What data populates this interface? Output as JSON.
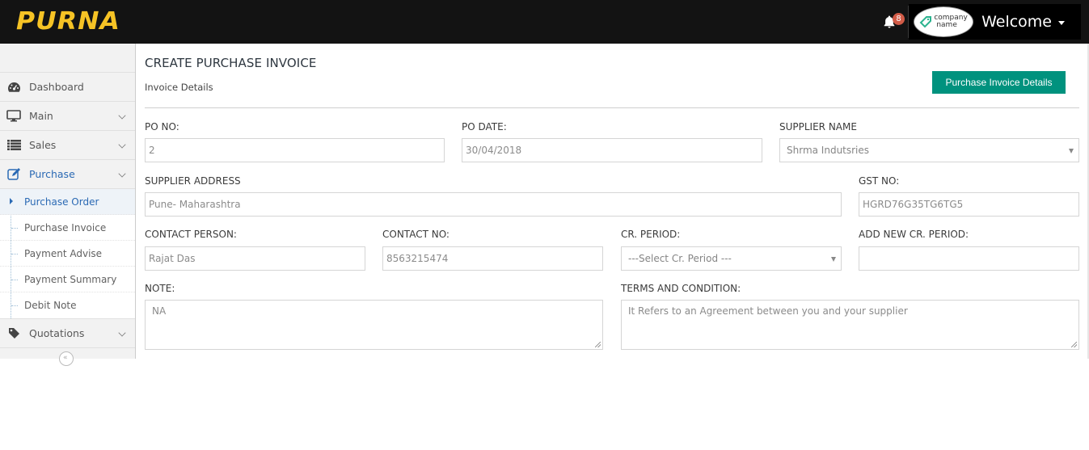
{
  "navbar": {
    "brand": "PURNA",
    "notification_count": "8",
    "company_logo_line1": "company",
    "company_logo_line2": "name",
    "welcome": "Welcome"
  },
  "sidebar": {
    "items": [
      {
        "label": "Dashboard",
        "icon": "tachometer-icon"
      },
      {
        "label": "Main",
        "icon": "desktop-icon"
      },
      {
        "label": "Sales",
        "icon": "list-icon"
      },
      {
        "label": "Purchase",
        "icon": "edit-icon"
      }
    ],
    "submenu": [
      {
        "label": "Purchase Order",
        "active": true
      },
      {
        "label": "Purchase Invoice"
      },
      {
        "label": "Payment Advise"
      },
      {
        "label": "Payment Summary"
      },
      {
        "label": "Debit Note"
      }
    ],
    "after_items": [
      {
        "label": "Quotations",
        "icon": "tag-icon"
      }
    ]
  },
  "main": {
    "title": "CREATE PURCHASE INVOICE",
    "subtitle": "Invoice Details",
    "details_button": "Purchase Invoice Details",
    "fields": {
      "po_no": {
        "label": "PO NO:",
        "value": "2"
      },
      "po_date": {
        "label": "PO DATE:",
        "value": "30/04/2018"
      },
      "supplier_name": {
        "label": "SUPPLIER NAME",
        "value": "Shrma Indutsries"
      },
      "supplier_address": {
        "label": "SUPPLIER ADDRESS",
        "value": "Pune- Maharashtra"
      },
      "gst_no": {
        "label": "GST NO:",
        "value": "HGRD76G35TG6TG5"
      },
      "contact_person": {
        "label": "CONTACT PERSON:",
        "value": "Rajat Das"
      },
      "contact_no": {
        "label": "CONTACT NO:",
        "value": "8563215474"
      },
      "cr_period": {
        "label": "CR. PERIOD:",
        "value": "---Select Cr. Period ---"
      },
      "add_cr_period": {
        "label": "ADD NEW CR. PERIOD:",
        "value": ""
      },
      "note": {
        "label": "NOTE:",
        "value": "NA"
      },
      "terms": {
        "label": "TERMS AND CONDITION:",
        "value": "It Refers to an Agreement between you and your supplier"
      }
    }
  },
  "colors": {
    "brand": "#f6c325",
    "navbar_bg": "#131313",
    "primary_button": "#00927e",
    "active_link": "#2b6ab4",
    "badge": "#d15b47"
  }
}
